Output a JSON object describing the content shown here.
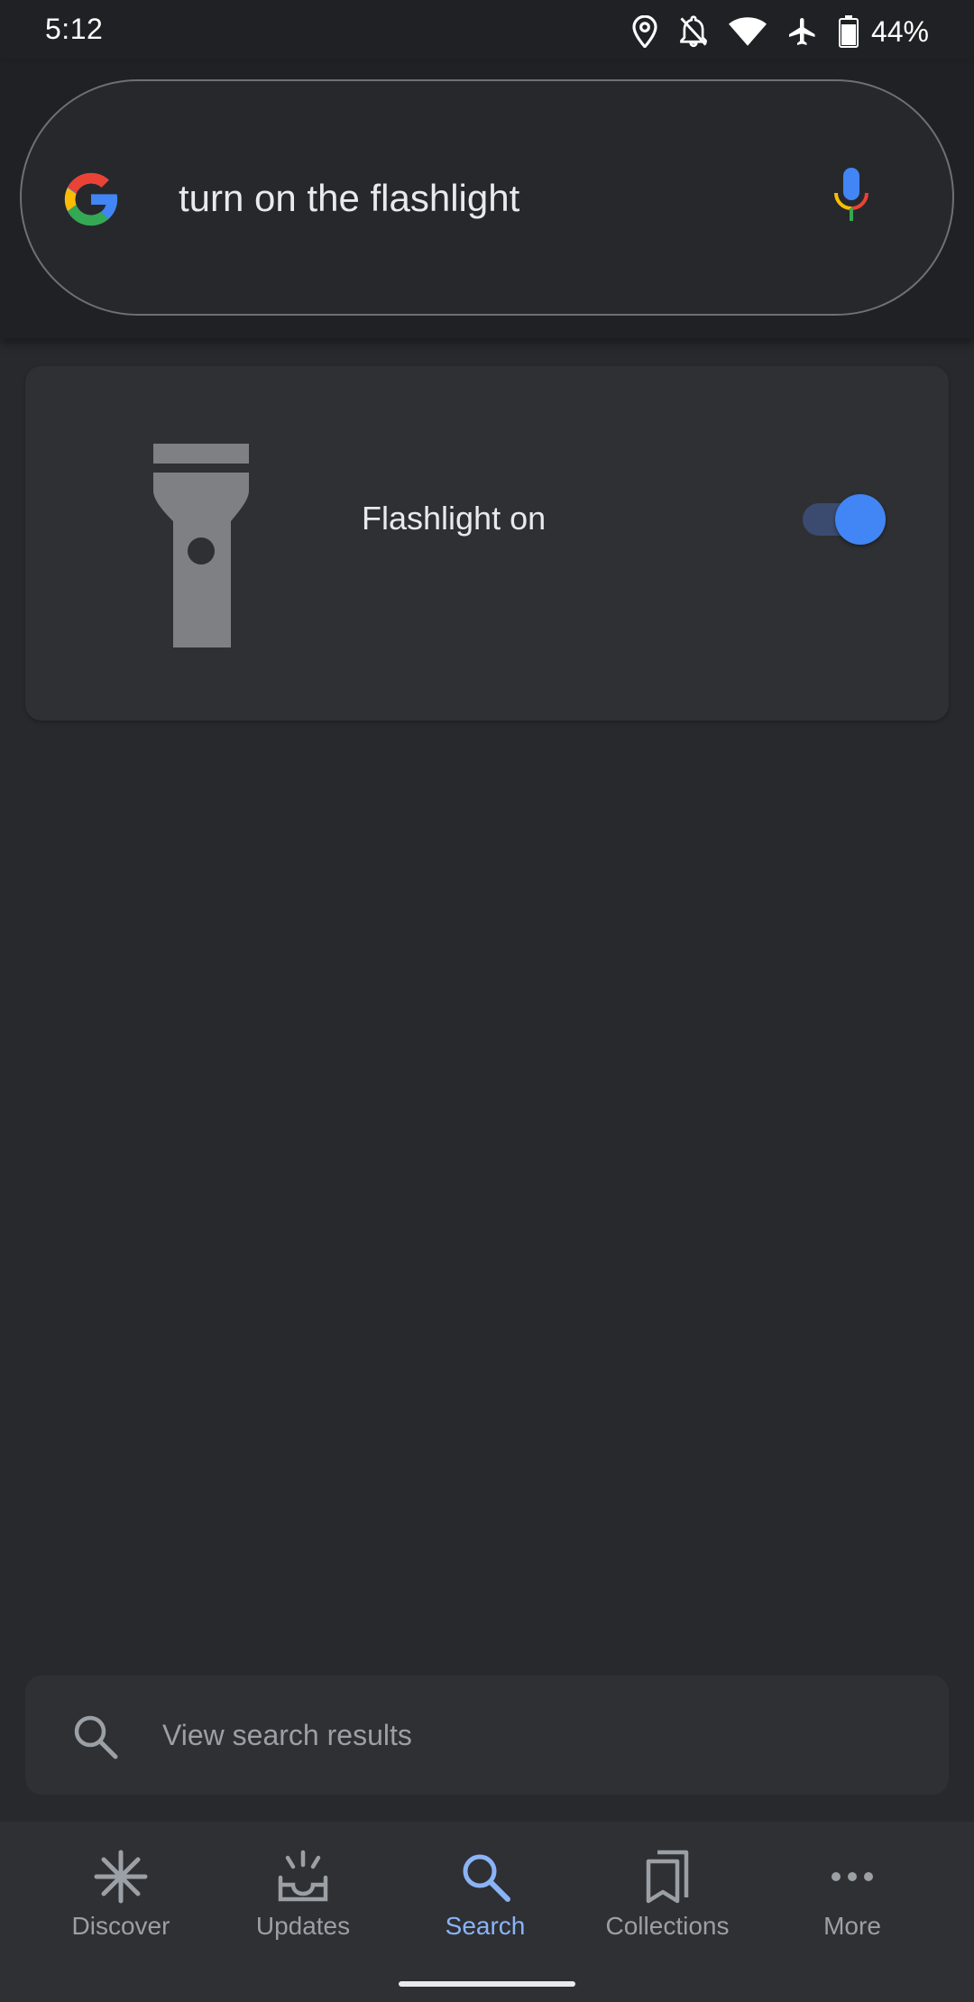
{
  "status_bar": {
    "time": "5:12",
    "battery": "44%",
    "icons": [
      "location-icon",
      "notifications-off-icon",
      "wifi-icon",
      "airplane-icon",
      "battery-icon"
    ]
  },
  "search": {
    "query": "turn on the flashlight",
    "logo": "google-g-logo",
    "mic": "mic-icon"
  },
  "flashlight_card": {
    "icon": "flashlight-icon",
    "label": "Flashlight on",
    "toggle_on": true,
    "accent": "#4285f4"
  },
  "results": {
    "label": "View search results",
    "icon": "search-icon"
  },
  "bottom_nav": {
    "items": [
      {
        "label": "Discover",
        "icon": "discover-icon",
        "active": false
      },
      {
        "label": "Updates",
        "icon": "updates-icon",
        "active": false
      },
      {
        "label": "Search",
        "icon": "search-icon",
        "active": true
      },
      {
        "label": "Collections",
        "icon": "collections-icon",
        "active": false
      },
      {
        "label": "More",
        "icon": "more-icon",
        "active": false
      }
    ],
    "active_color": "#8ab4f8"
  }
}
